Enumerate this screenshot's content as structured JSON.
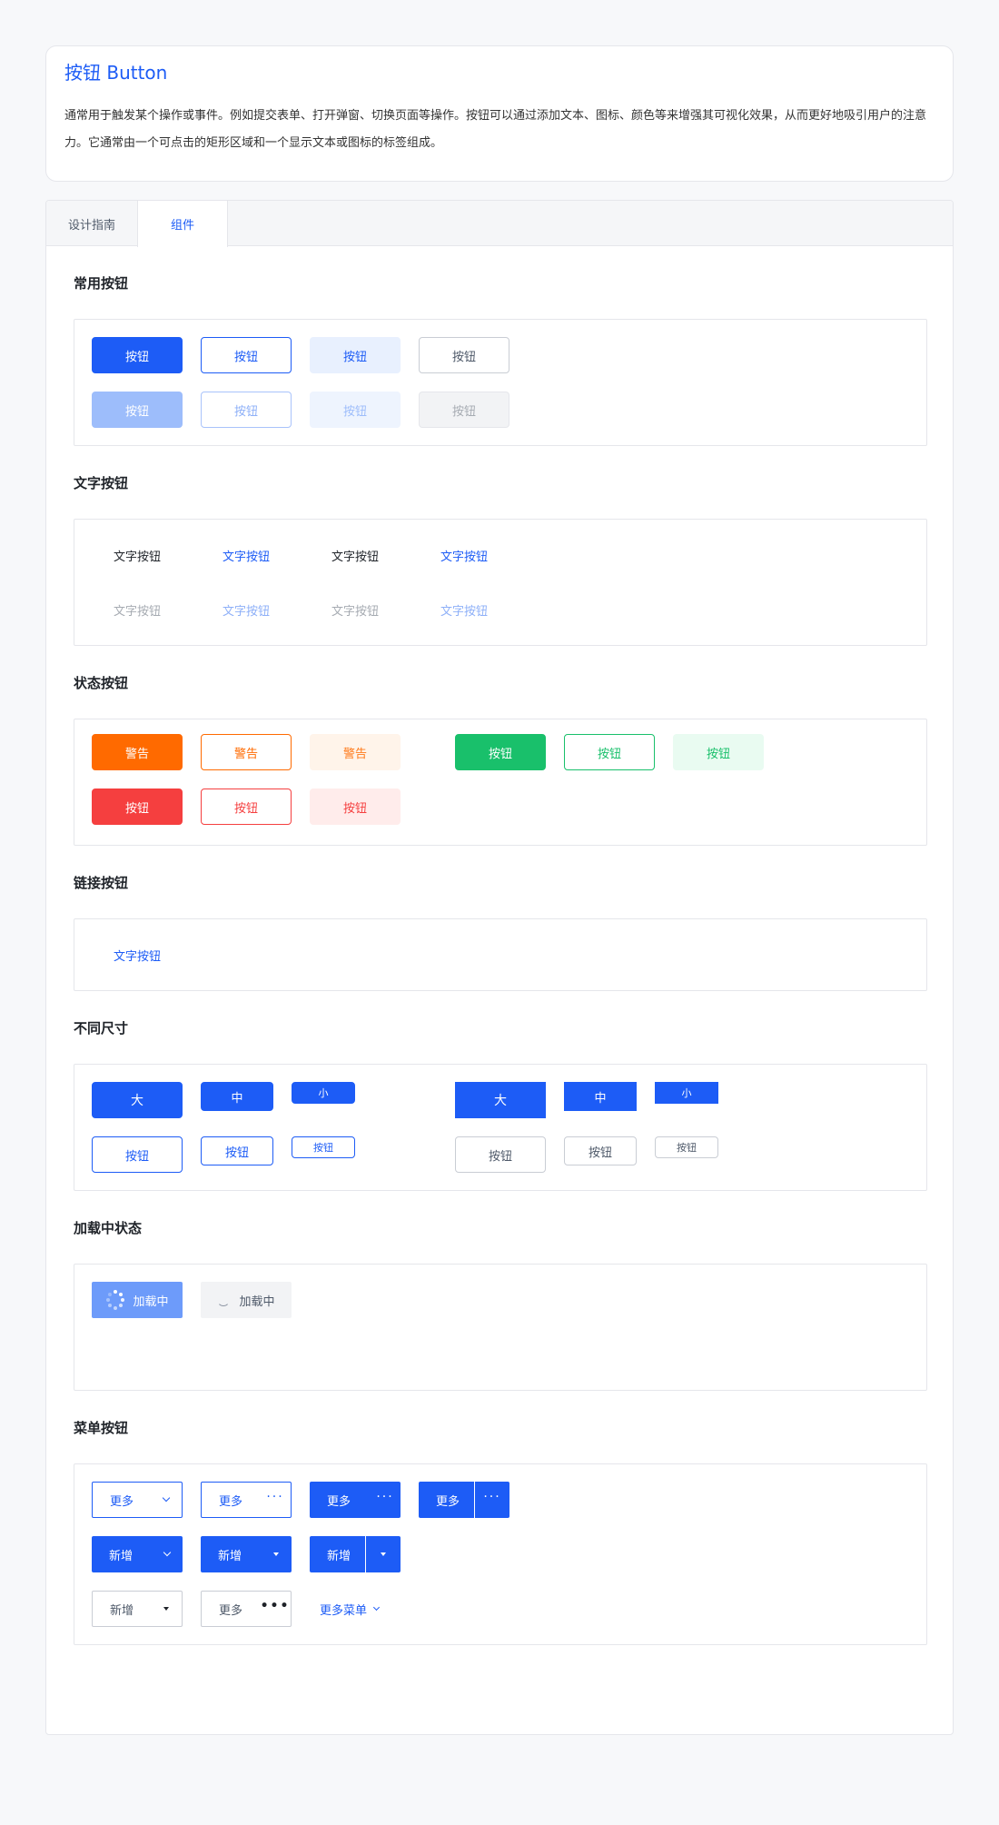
{
  "header": {
    "title": "按钮 Button",
    "description": "通常用于触发某个操作或事件。例如提交表单、打开弹窗、切换页面等操作。按钮可以通过添加文本、图标、颜色等来增强其可视化效果，从而更好地吸引用户的注意力。它通常由一个可点击的矩形区域和一个显示文本或图标的标签组成。"
  },
  "tabs": [
    {
      "label": "设计指南",
      "active": false
    },
    {
      "label": "组件",
      "active": true
    }
  ],
  "sections": {
    "common": "常用按钮",
    "text": "文字按钮",
    "status": "状态按钮",
    "link": "链接按钮",
    "size": "不同尺寸",
    "loading": "加载中状态",
    "menu": "菜单按钮"
  },
  "labels": {
    "button": "按钮",
    "text_button": "文字按钮",
    "warning": "警告",
    "large": "大",
    "medium": "中",
    "small": "小",
    "loading": "加载中",
    "more": "更多",
    "add": "新增",
    "more_menu": "更多菜单"
  },
  "colors": {
    "primary": "#1d5cf6",
    "warning": "#ff6a00",
    "success": "#19c06b",
    "danger": "#f53f3f"
  }
}
